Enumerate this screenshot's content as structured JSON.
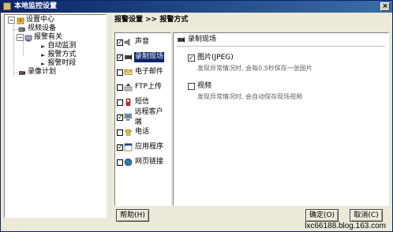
{
  "window": {
    "title": "本地监控设置",
    "close": "×"
  },
  "tree": {
    "root": "设置中心",
    "items": [
      {
        "label": "视频设备"
      },
      {
        "label": "报警有关"
      },
      {
        "label": "自动监测"
      },
      {
        "label": "报警方式"
      },
      {
        "label": "报警时段"
      },
      {
        "label": "录像计划"
      }
    ]
  },
  "header": {
    "breadcrumb": "报警设置  >>  报警方式"
  },
  "categories": [
    {
      "label": "声音",
      "checked": true
    },
    {
      "label": "录制现场",
      "checked": true,
      "selected": true
    },
    {
      "label": "电子邮件",
      "checked": false
    },
    {
      "label": "FTP上传",
      "checked": false
    },
    {
      "label": "短信",
      "checked": false
    },
    {
      "label": "远程客户端",
      "checked": true
    },
    {
      "label": "电话",
      "checked": false
    },
    {
      "label": "应用程序",
      "checked": true
    },
    {
      "label": "网页链接",
      "checked": false
    }
  ],
  "detail": {
    "title": "录制现场",
    "options": [
      {
        "label": "图片(JPEG)",
        "checked": true,
        "desc": "发现异常情况时, 会每0.5秒保存一张图片"
      },
      {
        "label": "视频",
        "checked": false,
        "desc": "发现异常情况时, 会自动保存现场视频"
      }
    ]
  },
  "buttons": {
    "help": "帮助(H)",
    "ok": "确定(O)",
    "cancel": "取消(C)"
  },
  "watermark": "lxc66188.blog.163.com",
  "colors": {
    "titlebar": "#0a246a",
    "selection": "#0a246a",
    "face": "#ece9d8"
  }
}
